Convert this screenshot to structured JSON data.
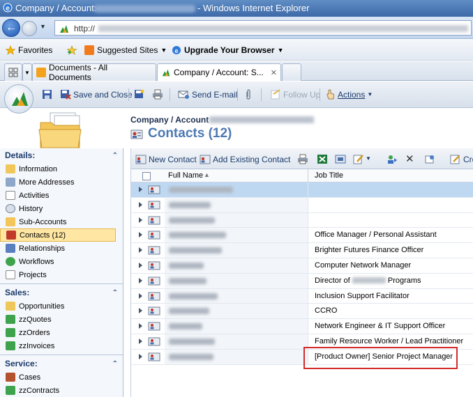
{
  "browser": {
    "title_prefix": "Company / Account:",
    "title_suffix": "- Windows Internet Explorer",
    "url_prefix": "http://"
  },
  "favorites_bar": {
    "favorites_label": "Favorites",
    "suggested_sites_label": "Suggested Sites",
    "upgrade_label": "Upgrade Your Browser"
  },
  "tabs": [
    {
      "label": "Documents - All Documents"
    },
    {
      "label": "Company / Account: S..."
    }
  ],
  "toolbar": {
    "save_close_label": "Save and Close",
    "send_email_label": "Send E-mail",
    "follow_up_label": "Follow Up",
    "actions_label": "Actions"
  },
  "header": {
    "breadcrumb": "Company / Account",
    "title": "Contacts (12)"
  },
  "left_nav": {
    "details": {
      "heading": "Details:",
      "items": [
        "Information",
        "More Addresses",
        "Activities",
        "History",
        "Sub-Accounts",
        "Contacts (12)",
        "Relationships",
        "Workflows",
        "Projects"
      ]
    },
    "sales": {
      "heading": "Sales:",
      "items": [
        "Opportunities",
        "zzQuotes",
        "zzOrders",
        "zzInvoices"
      ]
    },
    "service": {
      "heading": "Service:",
      "items": [
        "Cases",
        "zzContracts"
      ]
    }
  },
  "grid": {
    "new_contact_label": "New Contact",
    "add_existing_label": "Add Existing Contact",
    "overflow_label": "Cre",
    "columns": {
      "full_name": "Full Name",
      "job_title": "Job Title"
    },
    "rows": [
      {
        "job_title": ""
      },
      {
        "job_title": ""
      },
      {
        "job_title": ""
      },
      {
        "job_title": "Office Manager / Personal Assistant"
      },
      {
        "job_title": "Brighter Futures Finance Officer"
      },
      {
        "job_title": "Computer Network Manager"
      },
      {
        "job_title_prefix": "Director of",
        "job_title_suffix": "Programs"
      },
      {
        "job_title": "Inclusion Support Facilitator"
      },
      {
        "job_title": "CCRO"
      },
      {
        "job_title": "Network Engineer & IT Support Officer"
      },
      {
        "job_title": "Family Resource Worker / Lead Practitioner"
      },
      {
        "job_title": "[Product Owner] Senior Project Manager"
      }
    ]
  }
}
